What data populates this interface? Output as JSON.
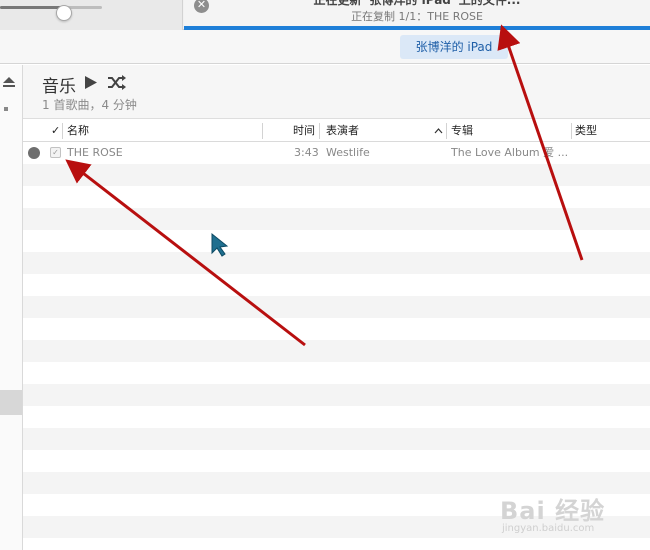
{
  "lcd": {
    "title": "正在更新“张博洋的 iPad”上的文件...",
    "subtitle": "正在复制 1/1：THE ROSE",
    "progress": 1.0
  },
  "device": {
    "name": "张博洋的 iPad"
  },
  "volume": {
    "level": 0.6
  },
  "header": {
    "title": "音乐",
    "subtitle": "1 首歌曲，4 分钟",
    "play_icon": "play-icon",
    "shuffle_icon": "shuffle-icon"
  },
  "table": {
    "columns": {
      "check": "✓",
      "name": "名称",
      "time": "时间",
      "artist": "表演者",
      "album": "专辑",
      "genre": "类型"
    },
    "rows": [
      {
        "checked": "✓",
        "name": "THE ROSE",
        "time": "3:43",
        "artist": "Westlife",
        "album": "The Love Album 爱 ...",
        "genre": ""
      }
    ]
  },
  "watermark": {
    "text": "Bai 经验",
    "sub": "jingyan.baidu.com"
  },
  "colors": {
    "accent": "#1e7fd8",
    "annotation_arrow": "#b80f0f",
    "device_pill_bg": "#dbe8f7"
  }
}
